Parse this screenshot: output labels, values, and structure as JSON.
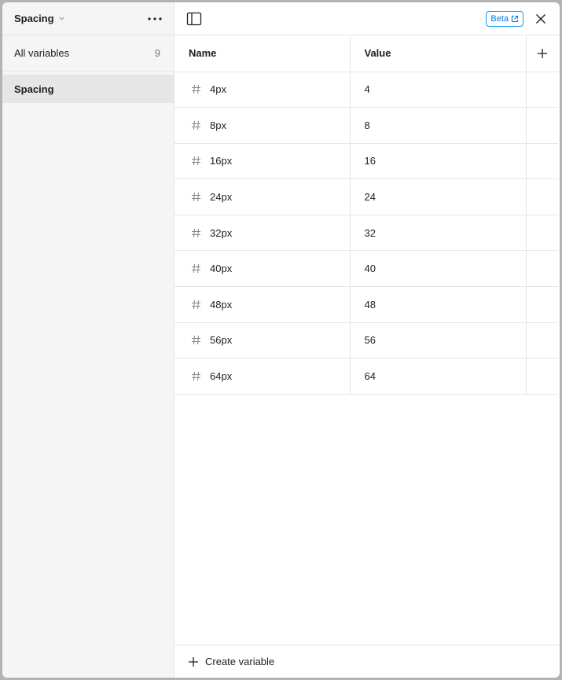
{
  "sidebar": {
    "collection_title": "Spacing",
    "all_variables": {
      "label": "All variables",
      "count": "9"
    },
    "groups": [
      {
        "label": "Spacing",
        "selected": true
      }
    ]
  },
  "topbar": {
    "beta_label": "Beta"
  },
  "table": {
    "headers": {
      "name": "Name",
      "value": "Value"
    },
    "rows": [
      {
        "name": "4px",
        "value": "4"
      },
      {
        "name": "8px",
        "value": "8"
      },
      {
        "name": "16px",
        "value": "16"
      },
      {
        "name": "24px",
        "value": "24"
      },
      {
        "name": "32px",
        "value": "32"
      },
      {
        "name": "40px",
        "value": "40"
      },
      {
        "name": "48px",
        "value": "48"
      },
      {
        "name": "56px",
        "value": "56"
      },
      {
        "name": "64px",
        "value": "64"
      }
    ]
  },
  "footer": {
    "create_label": "Create variable"
  },
  "colors": {
    "accent": "#0d99ff",
    "selected_bg": "#e6e6e6",
    "sidebar_bg": "#f5f5f5"
  },
  "icons": {
    "collection_menu": "chevron-down-icon",
    "more": "more-horizontal-icon",
    "sidebar_toggle": "sidebar-toggle-icon",
    "beta_link": "external-link-icon",
    "close": "close-icon",
    "add_column": "plus-icon",
    "variable_type": "hash-icon",
    "create": "plus-icon"
  }
}
